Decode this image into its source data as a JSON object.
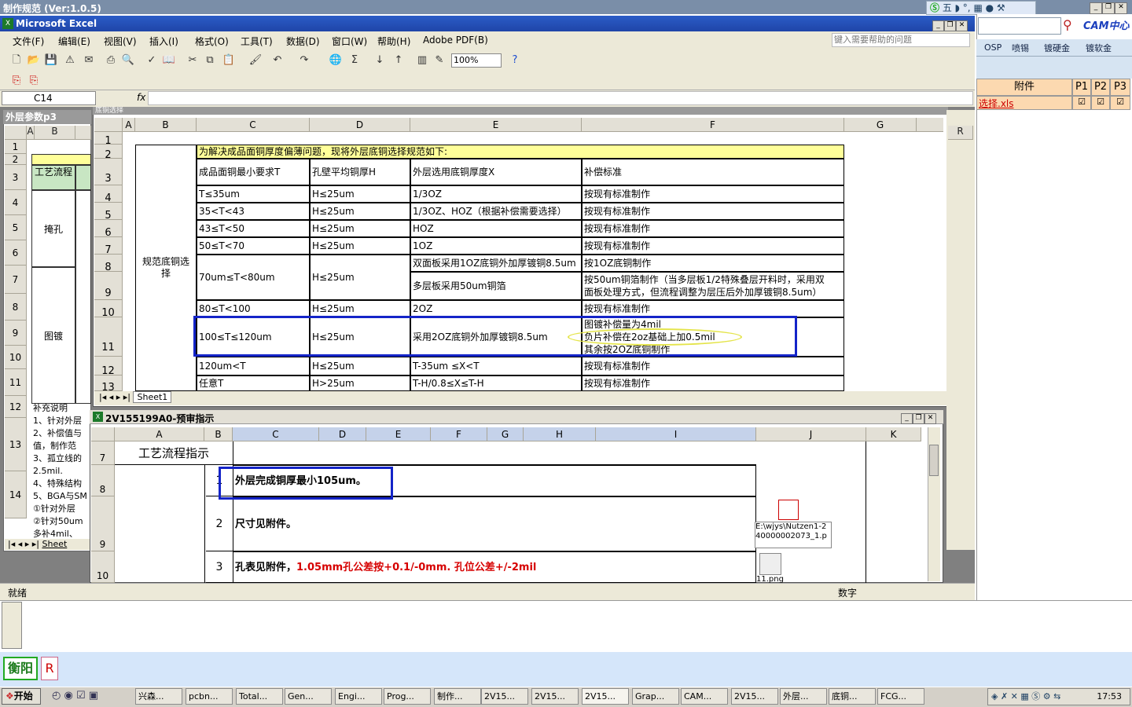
{
  "app_titlebar": "制作规范 (Ver:1.0.5)",
  "excel": {
    "title": "Microsoft Excel",
    "menu": [
      "文件(F)",
      "编辑(E)",
      "视图(V)",
      "插入(I)",
      "格式(O)",
      "工具(T)",
      "数据(D)",
      "窗口(W)",
      "帮助(H)",
      "Adobe PDF(B)"
    ],
    "help_placeholder": "键入需要帮助的问题",
    "zoom": "100%",
    "name_box": "C14",
    "fx": "fx",
    "status": "就绪",
    "status_right": "数字"
  },
  "right_panel": {
    "cam_label": "CAM中心",
    "tabs": [
      "OSP",
      "喷锡",
      "镀硬金",
      "镀软金"
    ],
    "table_headers": [
      "附件",
      "P1",
      "P2",
      "P3"
    ],
    "file_link": "选择.xls"
  },
  "back_sheet": {
    "title": "外层参数p3",
    "cols": [
      "A",
      "B"
    ],
    "rows": [
      "1",
      "2",
      "3",
      "4",
      "5",
      "6",
      "7",
      "8",
      "9",
      "10",
      "11",
      "12",
      "13",
      "14"
    ],
    "cell_process": "工艺流程",
    "cell_yankong": "掩孔",
    "cell_tudu": "图镀",
    "notes": [
      "补充说明",
      "1、针对外层",
      "2、补偿值与",
      "值，制作范",
      "3、孤立线的",
      "2.5mil.",
      "4、特殊结构",
      "5、BGA与SM",
      "①针对外层",
      "②针对50um",
      "多补4mil、"
    ],
    "sheet_tab": "Sheet"
  },
  "main_sheet": {
    "title": "底铜选择",
    "cols": [
      "A",
      "B",
      "C",
      "D",
      "E",
      "F",
      "G"
    ],
    "rows": [
      "1",
      "2",
      "3",
      "4",
      "5",
      "6",
      "7",
      "8",
      "9",
      "10",
      "11",
      "12",
      "13"
    ],
    "banner": "为解决成品面铜厚度偏薄问题，现将外层底铜选择规范如下:",
    "side_label": "规范底铜选择",
    "headers": [
      "成品面铜最小要求T",
      "孔壁平均铜厚H",
      "外层选用底铜厚度X",
      "补偿标准"
    ],
    "data": [
      [
        "T≤35um",
        "H≤25um",
        "1/3OZ",
        "按现有标准制作"
      ],
      [
        "35<T<43",
        "H≤25um",
        "1/3OZ、HOZ（根据补偿需要选择）",
        "按现有标准制作"
      ],
      [
        "43≤T<50",
        "H≤25um",
        "HOZ",
        "按现有标准制作"
      ],
      [
        "50≤T<70",
        "H≤25um",
        "1OZ",
        "按现有标准制作"
      ],
      [
        "70um≤T<80um",
        "H≤25um",
        "双面板采用1OZ底铜外加厚镀铜8.5um",
        "按1OZ底铜制作"
      ],
      [
        "",
        "",
        "多层板采用50um铜箔",
        "按50um铜箔制作（当多层板1/2特殊叠层开料时，采用双"
      ],
      [
        "80≤T<100",
        "H≤25um",
        "2OZ",
        "按现有标准制作"
      ],
      [
        "100≤T≤120um",
        "H≤25um",
        "采用2OZ底铜外加厚镀铜8.5um",
        "图镀补偿量为4mil"
      ],
      [
        "120um<T",
        "H≤25um",
        "T-35um ≤X<T",
        "按现有标准制作"
      ],
      [
        "任意T",
        "H>25um",
        "T-H/0.8≤X≤T-H",
        "按现有标准制作"
      ]
    ],
    "row9_line2": "面板处理方式，但流程调整为层压后外加厚镀铜8.5um）",
    "row11_line2": "负片补偿在2oz基础上加0.5mil",
    "row11_line3": "其余按2OZ底铜制作",
    "sheet_tab": "Sheet1"
  },
  "pre_review": {
    "title": "2V155199A0-预审指示",
    "cols": [
      "A",
      "B",
      "C",
      "D",
      "E",
      "F",
      "G",
      "H",
      "I",
      "J",
      "K"
    ],
    "rows": [
      "7",
      "8",
      "9",
      "10"
    ],
    "heading": "工艺流程指示",
    "items": [
      {
        "num": "1",
        "text": "外层完成铜厚最小105um。"
      },
      {
        "num": "2",
        "text": "尺寸见附件。"
      },
      {
        "num": "3",
        "text": "孔表见附件，",
        "red": "1.05mm孔公差按+0.1/-0mm. 孔位公差+/-2mil"
      }
    ],
    "attachment_path": "E:\\wjys\\Nutzen1-240000002073_1.p",
    "attachment2": "11.png"
  },
  "bottom": {
    "city": "衡阳",
    "r": "R"
  },
  "taskbar": {
    "start": "开始",
    "items": [
      "兴森...",
      "pcbn...",
      "Total...",
      "Gen...",
      "Engi...",
      "Prog...",
      "制作...",
      "2V15...",
      "2V15...",
      "2V15...",
      "Grap...",
      "CAM...",
      "2V15...",
      "外层...",
      "底铜...",
      "FCG..."
    ],
    "clock": "17:53"
  },
  "tray_ime": "五"
}
